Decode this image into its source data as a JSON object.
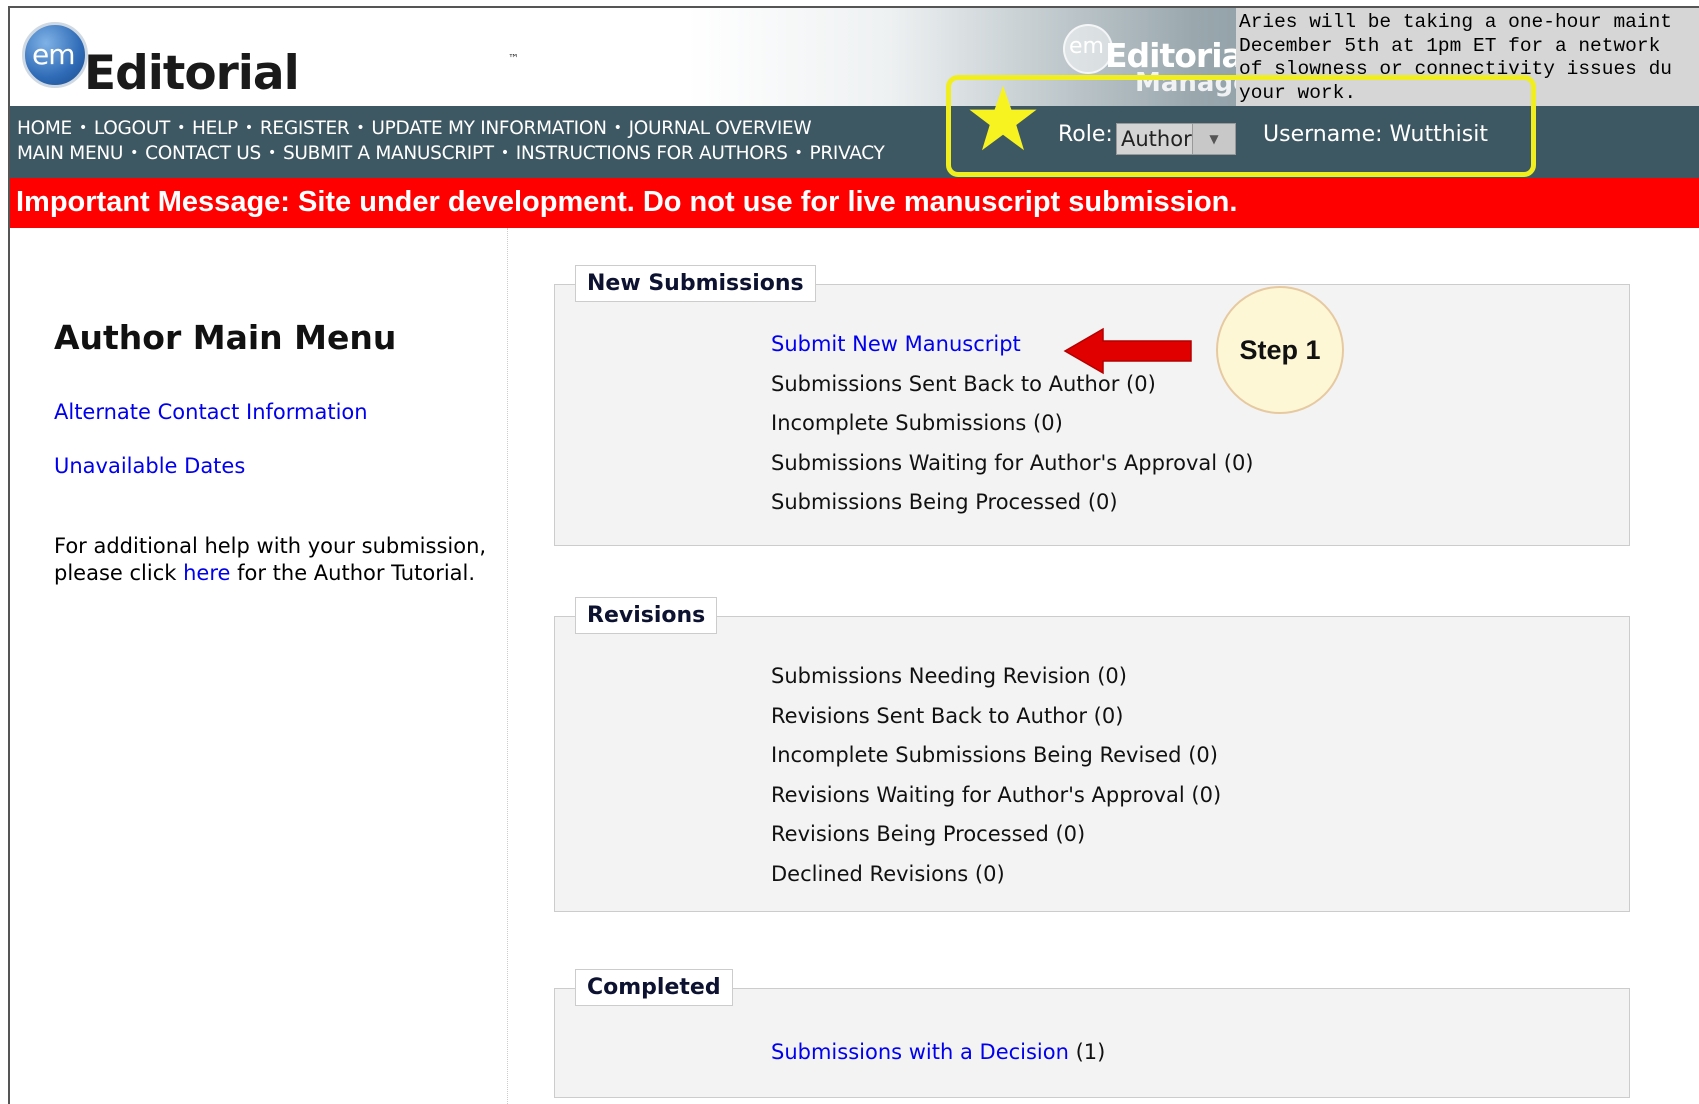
{
  "header": {
    "logo_em": "em",
    "logo_text": "Editorial Manager",
    "logo_tm": "™",
    "small_logo_em": "em",
    "small_logo_text": "Editorial",
    "small_logo_text2": "Manager",
    "notice_lines": "Aries will be taking a one-hour maint\nDecember 5th at 1pm ET for a network \nof slowness or connectivity issues du\nyour work."
  },
  "nav": {
    "row1": [
      "HOME",
      "LOGOUT",
      "HELP",
      "REGISTER",
      "UPDATE MY INFORMATION",
      "JOURNAL OVERVIEW"
    ],
    "row2": [
      "MAIN MENU",
      "CONTACT US",
      "SUBMIT A MANUSCRIPT",
      "INSTRUCTIONS FOR AUTHORS",
      "PRIVACY"
    ],
    "bullet": "•",
    "role_label": "Role:",
    "role_value": "Author",
    "username": "Username: Wutthisit"
  },
  "alert": {
    "text": "Important Message: Site under development. Do not use for live manuscript submission."
  },
  "left": {
    "title": "Author Main Menu",
    "alt_contact": "Alternate Contact Information",
    "unavailable": "Unavailable Dates",
    "help_pre": "For additional help with your submission, please click ",
    "help_link": "here",
    "help_post": " for the Author Tutorial."
  },
  "sections": {
    "new": {
      "legend": "New Submissions",
      "items": [
        {
          "label": "Submit New Manuscript",
          "count": ""
        },
        {
          "label": "Submissions Sent Back to Author",
          "count": " (0)"
        },
        {
          "label": "Incomplete Submissions",
          "count": " (0)"
        },
        {
          "label": "Submissions Waiting for Author's Approval",
          "count": " (0)"
        },
        {
          "label": "Submissions Being Processed",
          "count": " (0)"
        }
      ]
    },
    "revisions": {
      "legend": "Revisions",
      "items": [
        {
          "label": "Submissions Needing Revision",
          "count": " (0)"
        },
        {
          "label": "Revisions Sent Back to Author",
          "count": " (0)"
        },
        {
          "label": "Incomplete Submissions Being Revised",
          "count": " (0)"
        },
        {
          "label": "Revisions Waiting for Author's Approval",
          "count": " (0)"
        },
        {
          "label": "Revisions Being Processed ",
          "count": " (0)"
        },
        {
          "label": "Declined Revisions",
          "count": " (0)"
        }
      ]
    },
    "completed": {
      "legend": "Completed",
      "items": [
        {
          "label": "Submissions with a Decision",
          "count": " (1)"
        }
      ]
    }
  },
  "annotations": {
    "step_label": "Step 1",
    "highlight_color": "#f1ee1f",
    "arrow_color": "#e00000",
    "star_icon": "star-icon"
  }
}
